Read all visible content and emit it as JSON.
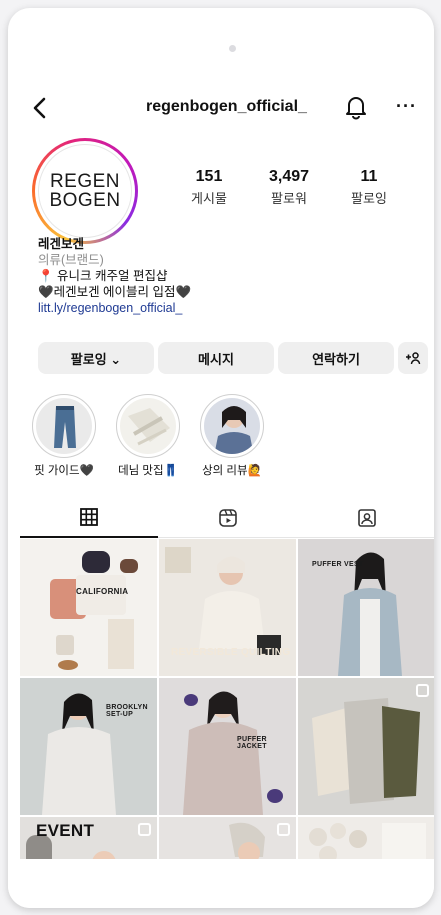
{
  "header": {
    "username": "regenbogen_official_",
    "icons": {
      "back": "chevron-left-icon",
      "notifications": "bell-icon",
      "more": "more-horizontal-icon"
    }
  },
  "profile": {
    "logo_line1": "REGEN",
    "logo_line2": "BOGEN",
    "stats": [
      {
        "value": "151",
        "label": "게시물"
      },
      {
        "value": "3,497",
        "label": "팔로워"
      },
      {
        "value": "11",
        "label": "팔로잉"
      }
    ],
    "name": "레겐보겐",
    "category": "의류(브랜드)",
    "bio_line1": "📍 유니크 캐주얼 편집샵",
    "bio_line2": "🖤레겐보겐 에이블리 입점🖤",
    "link": "litt.ly/regenbogen_official_"
  },
  "actions": {
    "following": "팔로잉 ⌄",
    "message": "메시지",
    "contact": "연락하기",
    "add_person_icon": "+"
  },
  "highlights": [
    {
      "label": "핏 가이드🖤"
    },
    {
      "label": "데님 맛집👖"
    },
    {
      "label": "상의 리뷰🙋"
    }
  ],
  "tabs": [
    {
      "name": "grid-icon"
    },
    {
      "name": "reels-icon"
    },
    {
      "name": "tagged-icon"
    }
  ],
  "posts": [
    {
      "caption": "CALIFORNIA"
    },
    {
      "caption": "REVERSIBLE QUILTING"
    },
    {
      "caption": "PUFFER VEST"
    },
    {
      "caption": "BROOKLYN SET-UP"
    },
    {
      "caption": "PUFFER JACKET"
    },
    {
      "caption": ""
    },
    {
      "caption": "EVENT"
    },
    {
      "caption": ""
    },
    {
      "caption": ""
    }
  ],
  "colors": {
    "accent_link": "#1f3a93",
    "button_bg": "#efefef",
    "ring_gradient": [
      "#f9c23c",
      "#e3247a",
      "#8a2be2"
    ]
  }
}
